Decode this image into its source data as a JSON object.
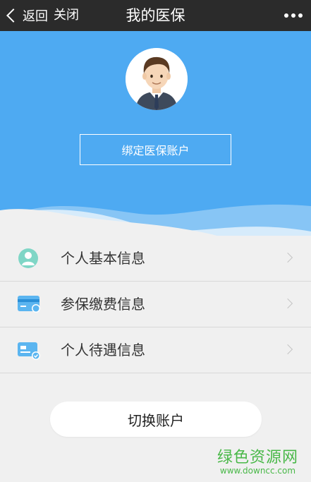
{
  "topbar": {
    "back_label": "返回",
    "close_label": "关闭",
    "title": "我的医保"
  },
  "hero": {
    "bind_label": "绑定医保账户",
    "background": "#4eaaf2"
  },
  "menu": {
    "items": [
      {
        "label": "个人基本信息",
        "icon": "person-icon"
      },
      {
        "label": "参保缴费信息",
        "icon": "card-icon"
      },
      {
        "label": "个人待遇信息",
        "icon": "card-check-icon"
      }
    ]
  },
  "switch_label": "切换账户",
  "watermark": {
    "main": "绿色资源网",
    "sub": "www.downcc.com"
  }
}
